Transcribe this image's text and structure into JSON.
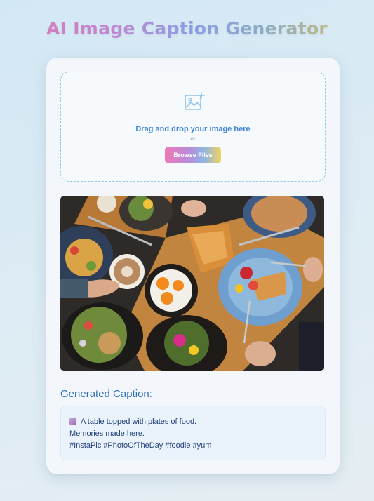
{
  "app": {
    "title": "AI Image Caption Generator"
  },
  "upload": {
    "prompt": "Drag and drop your image here",
    "or_text": "or",
    "browse_label": "Browse Files",
    "icon": "add-image-icon"
  },
  "preview": {
    "description": "uploaded-food-photo"
  },
  "caption": {
    "heading": "Generated Caption:",
    "emoji_icon": "framed-picture-emoji-icon",
    "lines": [
      "A table topped with plates of food.",
      "Memories made here.",
      "#InstaPic #PhotoOfTheDay #foodie #yum"
    ]
  },
  "colors": {
    "accent_blue": "#3f86d6",
    "heading_blue": "#2d6fbf",
    "dropzone_border": "#8ccbe6",
    "caption_bg": "#eaf2fc"
  }
}
